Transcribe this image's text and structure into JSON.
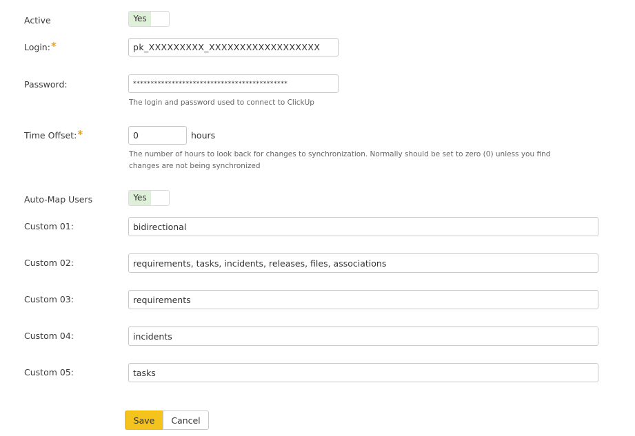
{
  "form": {
    "active": {
      "label": "Active",
      "toggle_label": "Yes"
    },
    "login": {
      "label": "Login:",
      "required_mark": "*",
      "value": "pk_XXXXXXXXX_XXXXXXXXXXXXXXXXXX"
    },
    "password": {
      "label": "Password:",
      "value": "********************************************",
      "help": "The login and password used to connect to ClickUp"
    },
    "time_offset": {
      "label": "Time Offset:",
      "required_mark": "*",
      "value": "0",
      "unit": "hours",
      "help_line1": "The number of hours to look back for changes to synchronization. Normally should be set to zero (0) unless you find",
      "help_line2": "changes are not being synchronized"
    },
    "auto_map_users": {
      "label": "Auto-Map Users",
      "toggle_label": "Yes"
    },
    "custom_01": {
      "label": "Custom 01:",
      "value": "bidirectional"
    },
    "custom_02": {
      "label": "Custom 02:",
      "value": "requirements, tasks, incidents, releases, files, associations"
    },
    "custom_03": {
      "label": "Custom 03:",
      "value": "requirements"
    },
    "custom_04": {
      "label": "Custom 04:",
      "value": "incidents"
    },
    "custom_05": {
      "label": "Custom 05:",
      "value": "tasks"
    }
  },
  "actions": {
    "save_label": "Save",
    "cancel_label": "Cancel"
  },
  "colors": {
    "toggle_on": "#dff0d8",
    "required": "#f0a000",
    "primary_button": "#f5c31e"
  }
}
